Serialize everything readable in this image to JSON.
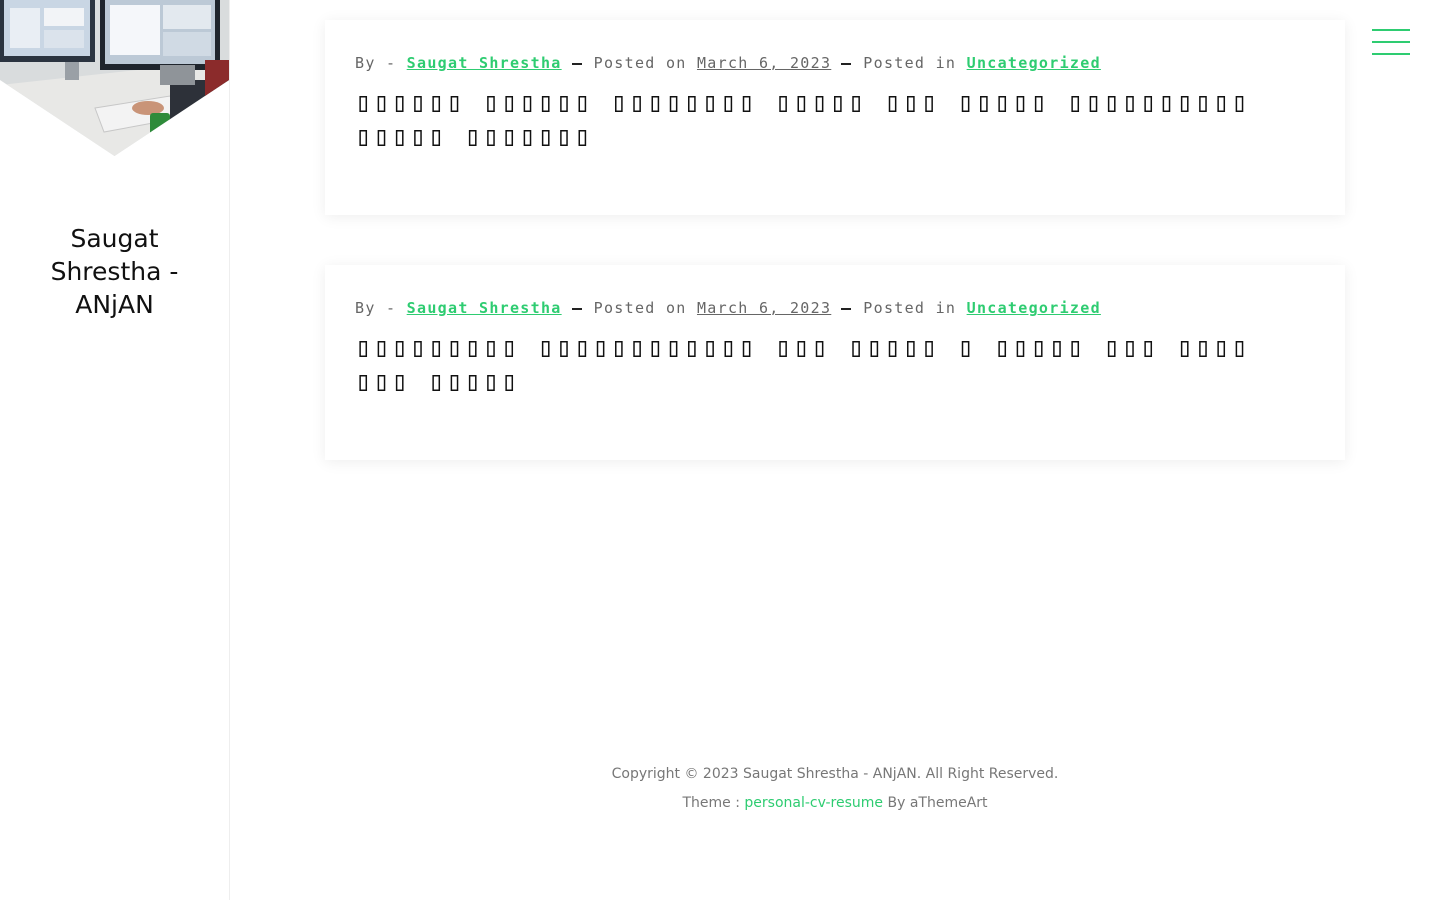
{
  "site": {
    "title": "Saugat Shrestha - ANjAN"
  },
  "posts": [
    {
      "by_label": "By -",
      "author": "Saugat Shrestha",
      "posted_on_label": "Posted on",
      "date": "March 6, 2023",
      "posted_in_label": "Posted in",
      "category": "Uncategorized",
      "title": "▯▯▯▯▯▯ ▯▯▯▯▯▯ ▯▯▯▯▯▯▯▯ ▯▯▯▯▯ ▯▯▯ ▯▯▯▯▯ ▯▯▯▯▯▯▯▯▯▯ ▯▯▯▯▯ ▯▯▯▯▯▯▯"
    },
    {
      "by_label": "By -",
      "author": "Saugat Shrestha",
      "posted_on_label": "Posted on",
      "date": "March 6, 2023",
      "posted_in_label": "Posted in",
      "category": "Uncategorized",
      "title": "▯▯▯▯▯▯▯▯▯ ▯▯▯▯▯▯▯▯▯▯▯▯ ▯▯▯ ▯▯▯▯▯ ▯ ▯▯▯▯▯ ▯▯▯ ▯▯▯▯ ▯▯▯ ▯▯▯▯▯"
    }
  ],
  "footer": {
    "copyright": "Copyright © 2023 Saugat Shrestha - ANjAN. All Right Reserved.",
    "theme_label": "Theme :",
    "theme_link": "personal-cv-resume",
    "by_text": "By aThemeArt"
  },
  "colors": {
    "accent": "#2ecc71",
    "text": "#111111",
    "muted": "#666666"
  },
  "icons": {
    "menu": "hamburger-menu-icon"
  }
}
